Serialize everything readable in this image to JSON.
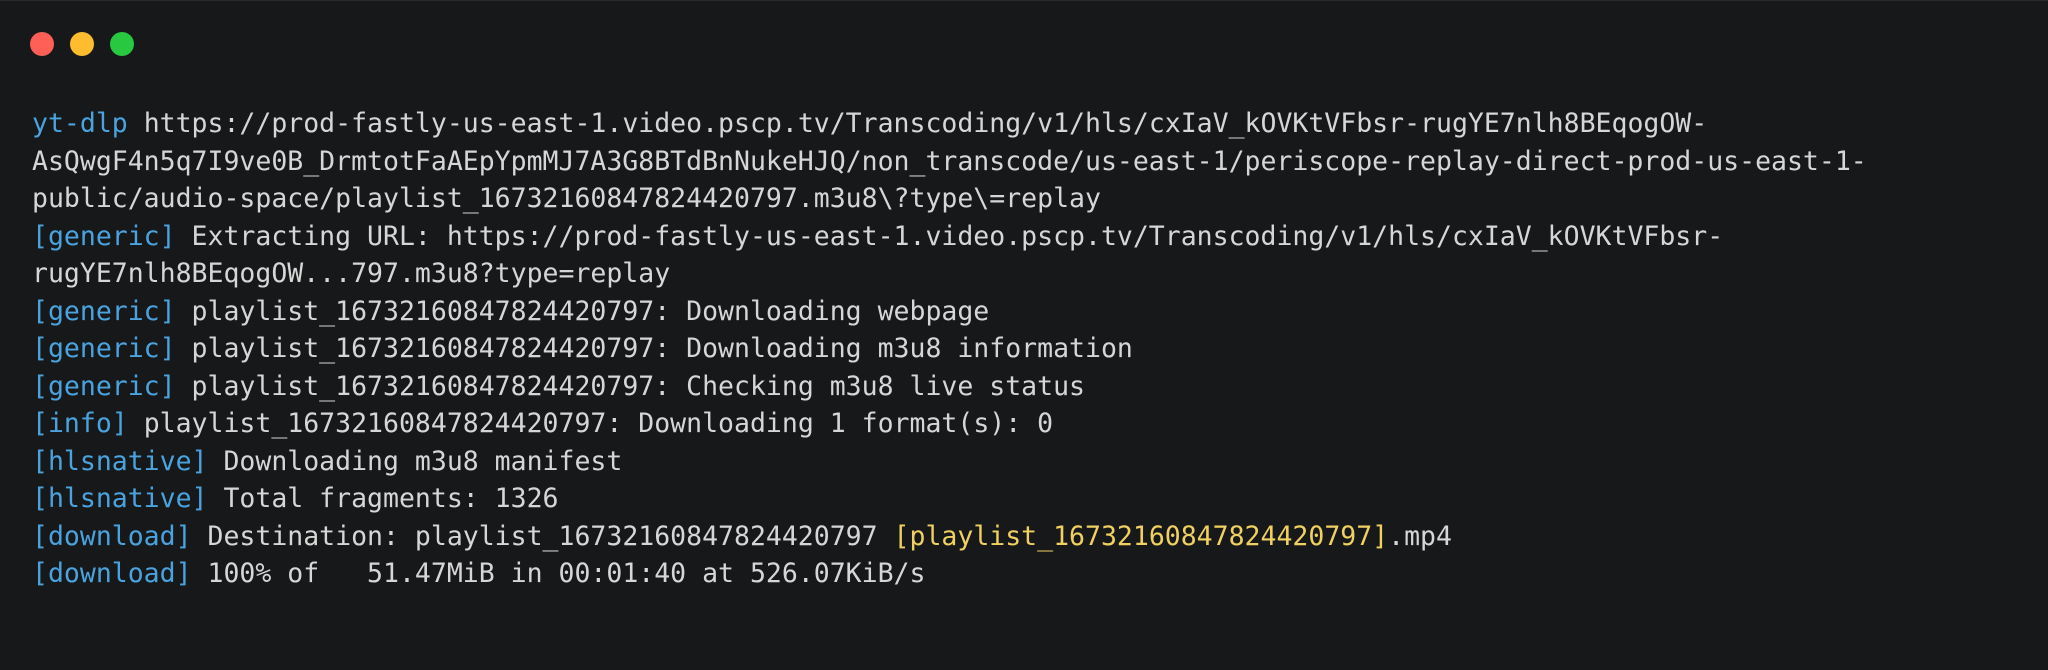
{
  "window": {
    "controls": [
      {
        "name": "close",
        "color": "#fe5f57"
      },
      {
        "name": "minimize",
        "color": "#febc2e"
      },
      {
        "name": "maximize",
        "color": "#28c840"
      }
    ]
  },
  "colors": {
    "background": "#17181a",
    "text": "#d6d6d6",
    "tag": "#4aa3df",
    "highlight": "#f0d060"
  },
  "terminal": {
    "lines": [
      [
        {
          "text": "yt-dlp",
          "style": "tag"
        },
        {
          "text": " https://prod-fastly-us-east-1.video.pscp.tv/Transcoding/v1/hls/cxIaV_kOVKtVFbsr-rugYE7nlh8BEqogOW-",
          "style": "text"
        }
      ],
      [
        {
          "text": "AsQwgF4n5q7I9ve0B_DrmtotFaAEpYpmMJ7A3G8BTdBnNukeHJQ/non_transcode/us-east-1/periscope-replay-direct-prod-us-east-1-",
          "style": "text"
        }
      ],
      [
        {
          "text": "public/audio-space/playlist_16732160847824420797.m3u8\\?type\\=replay",
          "style": "text"
        }
      ],
      [
        {
          "text": "[generic]",
          "style": "tag"
        },
        {
          "text": " Extracting URL: https://prod-fastly-us-east-1.video.pscp.tv/Transcoding/v1/hls/cxIaV_kOVKtVFbsr-",
          "style": "text"
        }
      ],
      [
        {
          "text": "rugYE7nlh8BEqogOW...797.m3u8?type=replay",
          "style": "text"
        }
      ],
      [
        {
          "text": "[generic]",
          "style": "tag"
        },
        {
          "text": " playlist_16732160847824420797: Downloading webpage",
          "style": "text"
        }
      ],
      [
        {
          "text": "[generic]",
          "style": "tag"
        },
        {
          "text": " playlist_16732160847824420797: Downloading m3u8 information",
          "style": "text"
        }
      ],
      [
        {
          "text": "[generic]",
          "style": "tag"
        },
        {
          "text": " playlist_16732160847824420797: Checking m3u8 live status",
          "style": "text"
        }
      ],
      [
        {
          "text": "[info]",
          "style": "tag"
        },
        {
          "text": " playlist_16732160847824420797: Downloading 1 format(s): 0",
          "style": "text"
        }
      ],
      [
        {
          "text": "[hlsnative]",
          "style": "tag"
        },
        {
          "text": " Downloading m3u8 manifest",
          "style": "text"
        }
      ],
      [
        {
          "text": "[hlsnative]",
          "style": "tag"
        },
        {
          "text": " Total fragments: 1326",
          "style": "text"
        }
      ],
      [
        {
          "text": "[download]",
          "style": "tag"
        },
        {
          "text": " Destination: playlist_16732160847824420797 ",
          "style": "text"
        },
        {
          "text": "[playlist_16732160847824420797]",
          "style": "highlight"
        },
        {
          "text": ".mp4",
          "style": "text"
        }
      ],
      [
        {
          "text": "[download]",
          "style": "tag"
        },
        {
          "text": " 100% of   51.47MiB in 00:01:40 at 526.07KiB/s",
          "style": "text"
        }
      ]
    ]
  }
}
